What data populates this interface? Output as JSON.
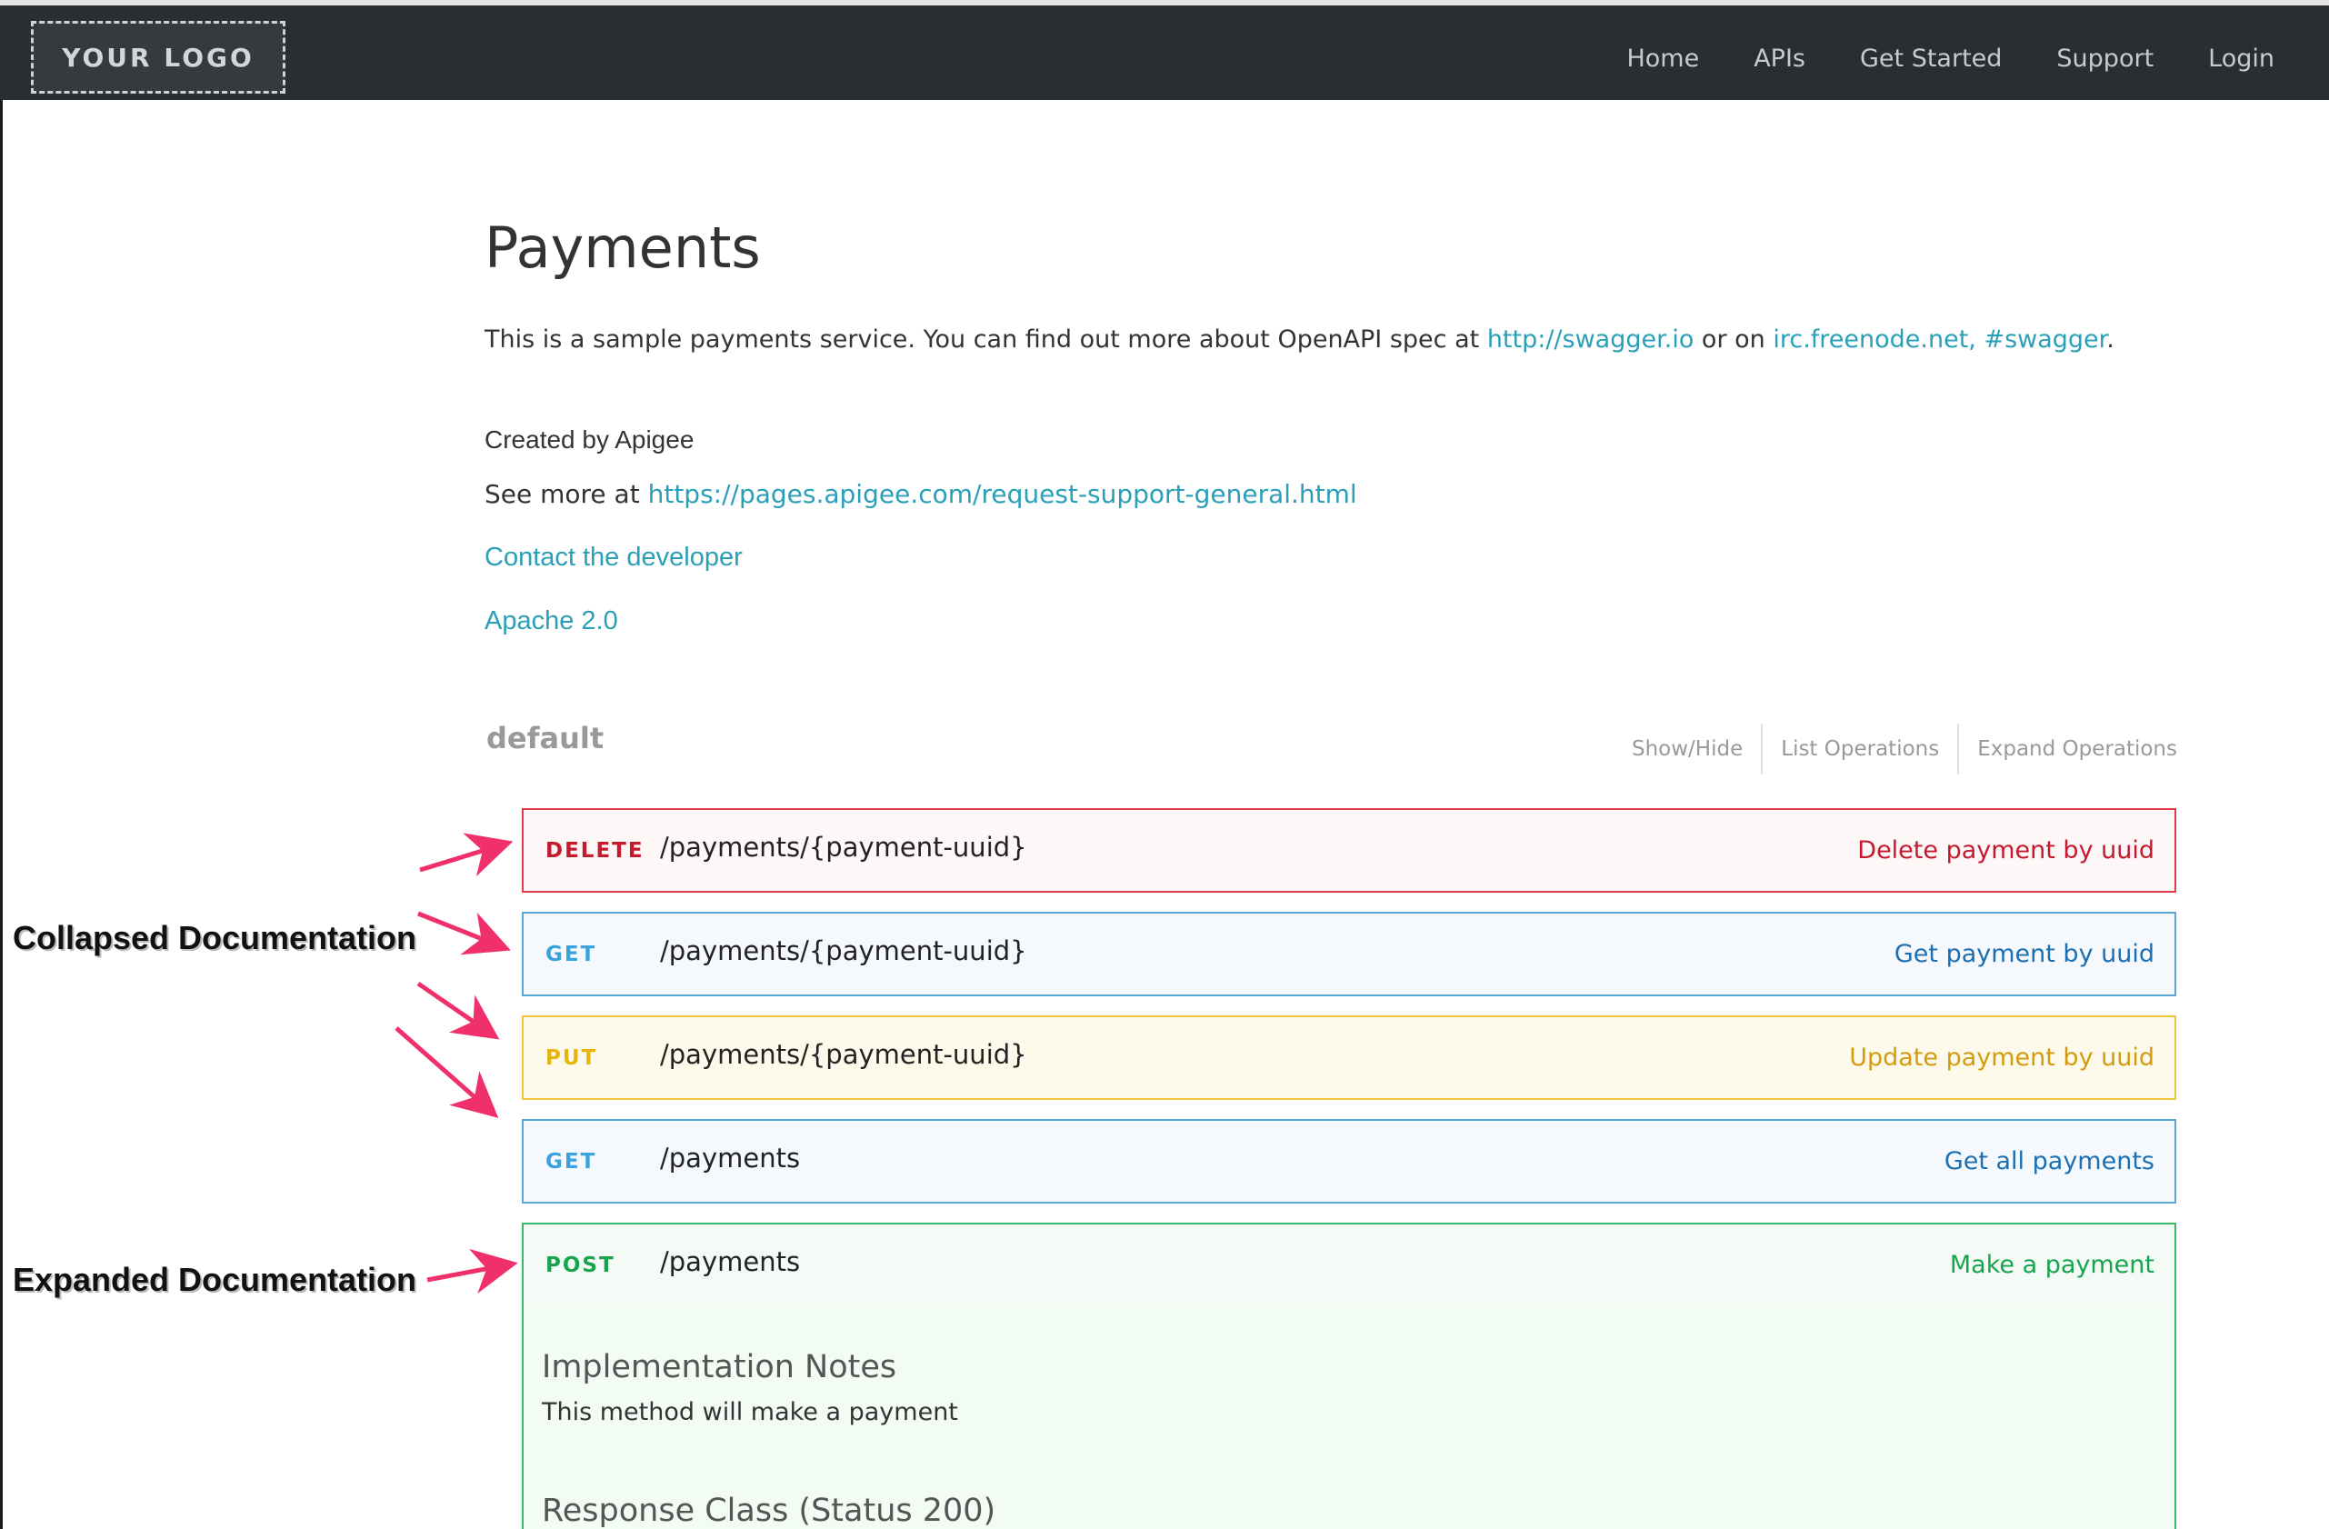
{
  "header": {
    "logo": "YOUR LOGO",
    "nav": [
      {
        "label": "Home"
      },
      {
        "label": "APIs"
      },
      {
        "label": "Get Started"
      },
      {
        "label": "Support"
      },
      {
        "label": "Login"
      }
    ]
  },
  "intro": {
    "title": "Payments",
    "description_prefix": "This is a sample payments service. You can find out more about OpenAPI spec at ",
    "swagger_link": "http://swagger.io",
    "description_middle": " or on ",
    "irc_link": "irc.freenode.net, #swagger",
    "description_suffix": ".",
    "created_by": "Created by Apigee",
    "see_more_prefix": "See more at ",
    "see_more_link": "https://pages.apigee.com/request-support-general.html",
    "contact": "Contact the developer",
    "license": "Apache 2.0"
  },
  "resource": {
    "name": "default",
    "show_hide": "Show/Hide",
    "list_operations": "List Operations",
    "expand_operations": "Expand Operations"
  },
  "endpoints": [
    {
      "method": "DELETE",
      "path": "/payments/{payment-uuid}",
      "summary": "Delete payment by uuid"
    },
    {
      "method": "GET",
      "path": "/payments/{payment-uuid}",
      "summary": "Get payment by uuid"
    },
    {
      "method": "PUT",
      "path": "/payments/{payment-uuid}",
      "summary": "Update payment by uuid"
    },
    {
      "method": "GET",
      "path": "/payments",
      "summary": "Get all payments"
    },
    {
      "method": "POST",
      "path": "/payments",
      "summary": "Make a payment"
    }
  ],
  "expanded": {
    "implementation_title": "Implementation Notes",
    "implementation_text": "This method will make a payment",
    "response_title": "Response Class (Status 200)"
  },
  "annotations": {
    "collapsed": "Collapsed Documentation",
    "expanded": "Expanded Documentation"
  },
  "colors": {
    "link": "#2a9fb8",
    "delete": "#e33b4e",
    "get": "#5aa7d6",
    "put": "#f0c53a",
    "post": "#3ab66a",
    "arrow": "#f0306a"
  }
}
